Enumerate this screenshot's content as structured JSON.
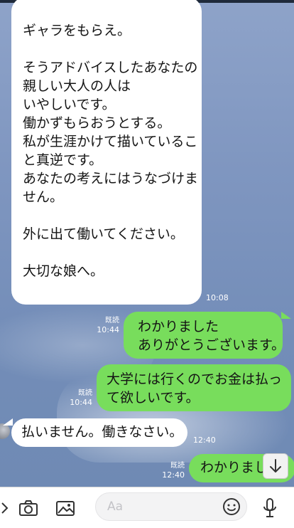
{
  "messages": [
    {
      "id": "m1",
      "side": "left",
      "lines": [
        "ギャラをもらえ。",
        "",
        "そうアドバイスしたあなたの",
        "親しい大人の人は",
        "いやしいです。",
        "働かずもらおうとする。",
        "私が生涯かけて描いているこ",
        "と真逆です。",
        "あなたの考えにはうなづけま",
        "せん。",
        "",
        "外に出て働いてください。",
        "",
        "大切な娘へ。"
      ],
      "time": "10:08"
    },
    {
      "id": "m2",
      "side": "right",
      "lines": [
        "わかりました",
        "ありがとうございます。"
      ],
      "read": "既読",
      "time": "10:44"
    },
    {
      "id": "m3",
      "side": "right",
      "lines": [
        "大学には行くのでお金は払っ",
        "て欲しいです。"
      ],
      "read": "既読",
      "time": "10:44"
    },
    {
      "id": "m4",
      "side": "left",
      "lines": [
        "払いません。働きなさい。"
      ],
      "time": "12:40"
    },
    {
      "id": "m5",
      "side": "right",
      "lines": [
        "わかりまし"
      ],
      "read": "既読",
      "time": "12:40"
    }
  ],
  "input": {
    "placeholder": "Aa"
  },
  "icons": {
    "menu": "chevron-right-icon",
    "camera": "camera-icon",
    "image": "image-icon",
    "emoji": "emoji-icon",
    "mic": "microphone-icon",
    "scroll": "arrow-down-icon"
  },
  "colors": {
    "sent_bubble": "#78dd5c",
    "received_bubble": "#ffffff",
    "chat_background": "#7f96c0"
  }
}
